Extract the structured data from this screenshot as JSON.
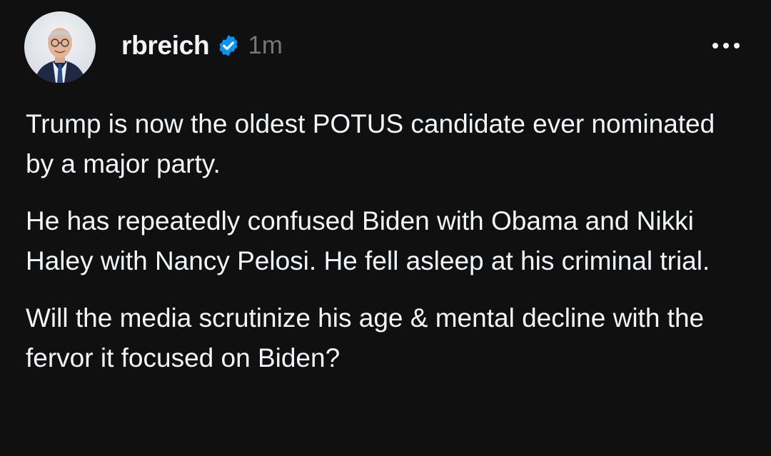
{
  "post": {
    "username": "rbreich",
    "timestamp": "1m",
    "verified_icon": "verified-badge-icon",
    "more_icon": "ellipsis-icon",
    "avatar": "profile-avatar",
    "paragraphs": [
      "Trump is now the oldest POTUS candidate ever nominated by a major party.",
      "He has repeatedly confused Biden with Obama and Nikki Haley with Nancy Pelosi. He fell asleep at his criminal trial.",
      "Will the media scrutinize his age & mental decline with the fervor it focused on Biden?"
    ]
  },
  "colors": {
    "background": "#101010",
    "text": "#f3f5f7",
    "muted": "#777777",
    "verified": "#0095f6"
  }
}
